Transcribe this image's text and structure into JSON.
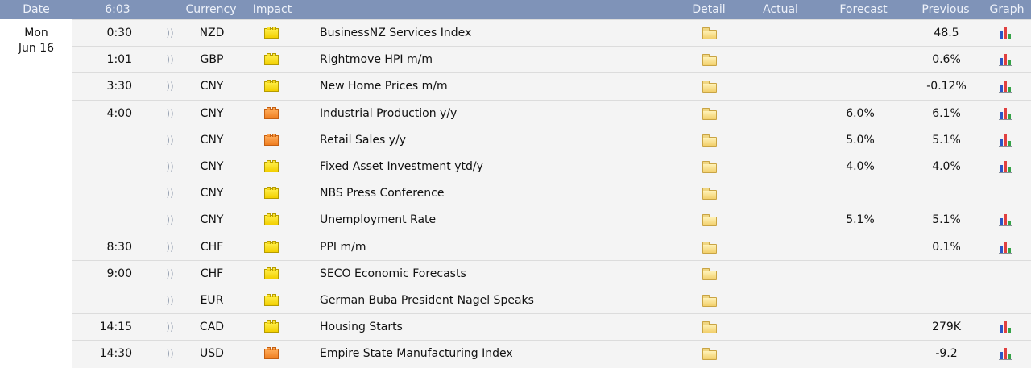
{
  "header": {
    "date": "Date",
    "time": "6:03",
    "currency": "Currency",
    "impact": "Impact",
    "detail": "Detail",
    "actual": "Actual",
    "forecast": "Forecast",
    "previous": "Previous",
    "graph": "Graph"
  },
  "date": {
    "weekday": "Mon",
    "day": "Jun 16"
  },
  "colors": {
    "header_bg": "#7f93b8",
    "row_bg": "#f4f4f4",
    "impact_low": "#f2cf00",
    "impact_medium": "#ef7d1f"
  },
  "icons": {
    "sound": "sound-icon",
    "impact_low": "low-impact-folder-icon",
    "impact_medium": "medium-impact-folder-icon",
    "detail": "detail-folder-icon",
    "graph": "bar-graph-icon"
  },
  "rows": [
    {
      "time": "0:30",
      "currency": "NZD",
      "impact": "low",
      "event": "BusinessNZ Services Index",
      "actual": "",
      "forecast": "",
      "previous": "48.5",
      "graph": true
    },
    {
      "time": "1:01",
      "currency": "GBP",
      "impact": "low",
      "event": "Rightmove HPI m/m",
      "actual": "",
      "forecast": "",
      "previous": "0.6%",
      "graph": true
    },
    {
      "time": "3:30",
      "currency": "CNY",
      "impact": "low",
      "event": "New Home Prices m/m",
      "actual": "",
      "forecast": "",
      "previous": "-0.12%",
      "graph": true
    },
    {
      "time": "4:00",
      "currency": "CNY",
      "impact": "medium",
      "event": "Industrial Production y/y",
      "actual": "",
      "forecast": "6.0%",
      "previous": "6.1%",
      "graph": true
    },
    {
      "time": "",
      "currency": "CNY",
      "impact": "medium",
      "event": "Retail Sales y/y",
      "actual": "",
      "forecast": "5.0%",
      "previous": "5.1%",
      "graph": true
    },
    {
      "time": "",
      "currency": "CNY",
      "impact": "low",
      "event": "Fixed Asset Investment ytd/y",
      "actual": "",
      "forecast": "4.0%",
      "previous": "4.0%",
      "graph": true
    },
    {
      "time": "",
      "currency": "CNY",
      "impact": "low",
      "event": "NBS Press Conference",
      "actual": "",
      "forecast": "",
      "previous": "",
      "graph": false
    },
    {
      "time": "",
      "currency": "CNY",
      "impact": "low",
      "event": "Unemployment Rate",
      "actual": "",
      "forecast": "5.1%",
      "previous": "5.1%",
      "graph": true
    },
    {
      "time": "8:30",
      "currency": "CHF",
      "impact": "low",
      "event": "PPI m/m",
      "actual": "",
      "forecast": "",
      "previous": "0.1%",
      "graph": true
    },
    {
      "time": "9:00",
      "currency": "CHF",
      "impact": "low",
      "event": "SECO Economic Forecasts",
      "actual": "",
      "forecast": "",
      "previous": "",
      "graph": false
    },
    {
      "time": "",
      "currency": "EUR",
      "impact": "low",
      "event": "German Buba President Nagel Speaks",
      "actual": "",
      "forecast": "",
      "previous": "",
      "graph": false
    },
    {
      "time": "14:15",
      "currency": "CAD",
      "impact": "low",
      "event": "Housing Starts",
      "actual": "",
      "forecast": "",
      "previous": "279K",
      "graph": true
    },
    {
      "time": "14:30",
      "currency": "USD",
      "impact": "medium",
      "event": "Empire State Manufacturing Index",
      "actual": "",
      "forecast": "",
      "previous": "-9.2",
      "graph": true
    }
  ]
}
